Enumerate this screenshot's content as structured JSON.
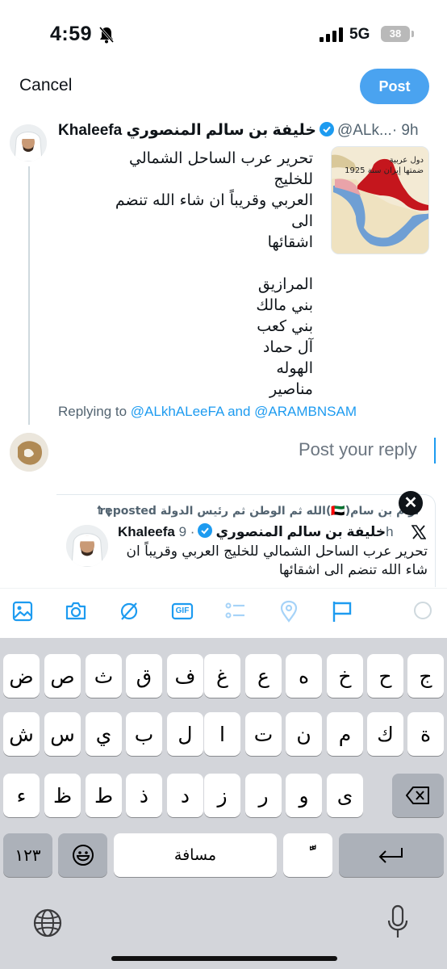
{
  "status_bar": {
    "time": "4:59",
    "network": "5G",
    "battery": "38"
  },
  "compose": {
    "cancel_label": "Cancel",
    "post_label": "Post"
  },
  "original_post": {
    "author": "Khaleefa خليفة بن سالم المنصوري",
    "handle": "@ALk...",
    "time": "· 9h",
    "text_lines": [
      "تحرير عرب الساحل الشمالي للخليج",
      "العربي وقريباً ان شاء الله تنضم الى",
      "اشقائها",
      "",
      "المرازيق",
      "بني مالك",
      "بني كعب",
      "آل حماد",
      "الهوله",
      "مناصير"
    ],
    "media_caption": [
      "دول عربية",
      "ضمتها إيران سنة 1925"
    ],
    "replying_prefix": "Replying to",
    "replying_mentions": "@ALkhALeeFA and @ARAMBNSAM"
  },
  "reply": {
    "placeholder": "Post your reply"
  },
  "quoted_post": {
    "repost_text": "ارام بن سام(🇦🇪)الله ثم الوطن ثم رئيس الدولة reposted",
    "author": "Khaleefa خليفة بن سالم المنصوري",
    "time": "· 9h",
    "text": "تحرير عرب الساحل الشمالي للخليج العربي وقريباً ان شاء الله تنضم الى اشقائها",
    "close_symbol": "✕"
  },
  "toolbar": {
    "icons": [
      "image-icon",
      "camera-icon",
      "gif-search-icon",
      "gif-icon",
      "poll-icon",
      "location-icon",
      "flag-icon"
    ],
    "gif_label": "GIF"
  },
  "keyboard": {
    "row1": [
      "ض",
      "ص",
      "ث",
      "ق",
      "ف",
      "غ",
      "ع",
      "ه",
      "خ",
      "ح",
      "ج"
    ],
    "row2": [
      "ش",
      "س",
      "ي",
      "ب",
      "ل",
      "ا",
      "ت",
      "ن",
      "م",
      "ك",
      "ة"
    ],
    "row3": [
      "ء",
      "ظ",
      "ط",
      "ذ",
      "د",
      "ز",
      "ر",
      "و",
      "ى"
    ],
    "numbers_label": "١٢٣",
    "space_label": "مسافة",
    "diacritic_label": "ًّ"
  },
  "colors": {
    "accent": "#1d9bf0",
    "post_button": "#4aa3f0",
    "keyboard_bg": "#d3d5da"
  }
}
